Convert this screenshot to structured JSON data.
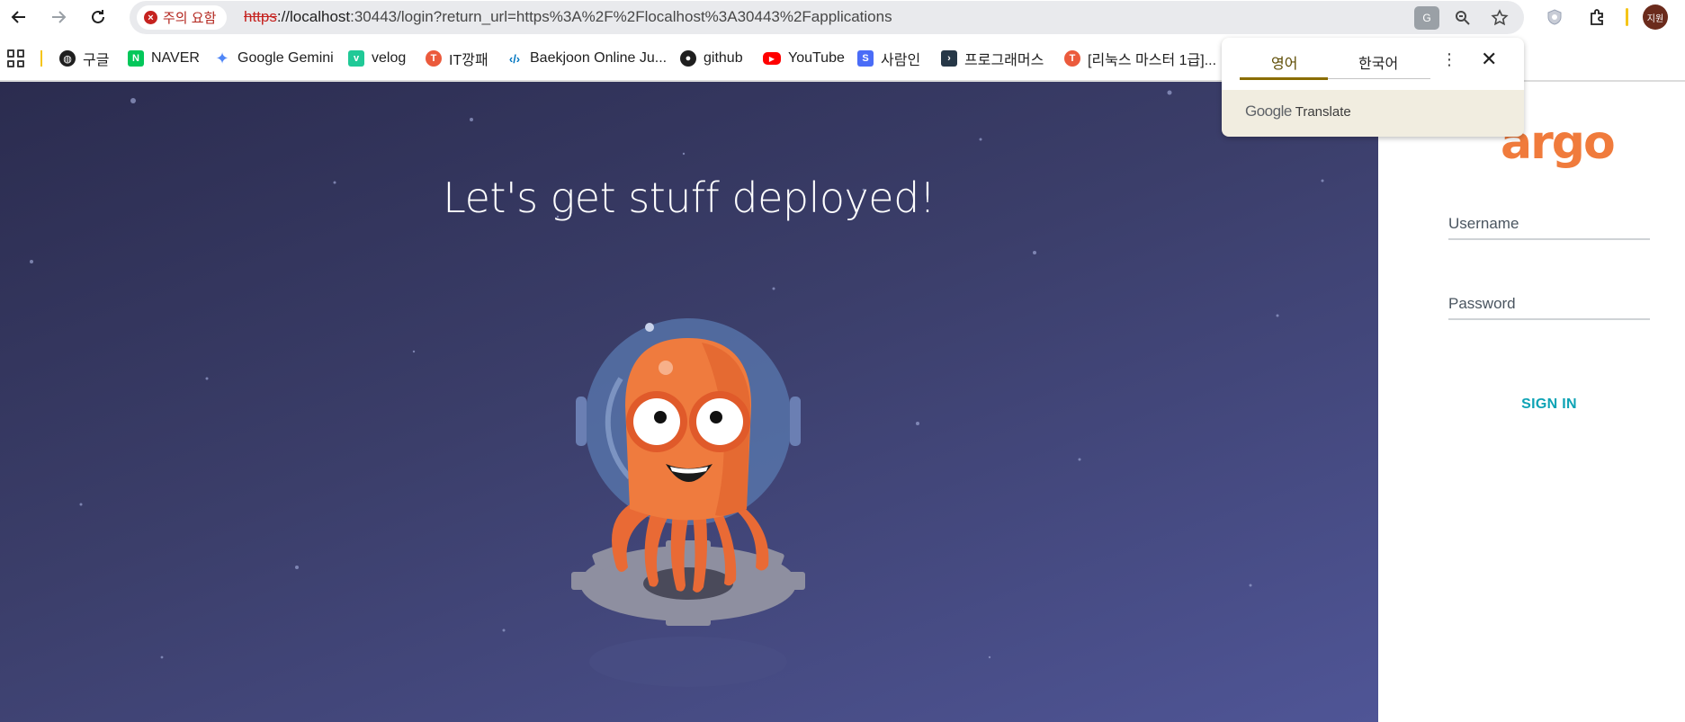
{
  "browser": {
    "security_chip": "주의 요함",
    "url_scheme": "https",
    "url_host": "://localhost",
    "url_rest": ":30443/login?return_url=https%3A%2F%2Flocalhost%3A30443%2Fapplications",
    "avatar_text": "지원"
  },
  "bookmarks": [
    {
      "label": "구글",
      "icon": "globe-icon",
      "color": "#1f1f1f"
    },
    {
      "label": "NAVER",
      "icon": "naver-icon",
      "color": "#03c75a"
    },
    {
      "label": "Google Gemini",
      "icon": "gemini-icon",
      "color": "#4f86f7"
    },
    {
      "label": "velog",
      "icon": "velog-icon",
      "color": "#20c997"
    },
    {
      "label": "IT깡패",
      "icon": "tistory-icon",
      "color": "#eb5a3c"
    },
    {
      "label": "Baekjoon Online Ju...",
      "icon": "code-icon",
      "color": "#0076c0"
    },
    {
      "label": "github",
      "icon": "github-icon",
      "color": "#1f1f1f"
    },
    {
      "label": "YouTube",
      "icon": "youtube-icon",
      "color": "#ff0000"
    },
    {
      "label": "사람인",
      "icon": "saramin-icon",
      "color": "#4a6cf7"
    },
    {
      "label": "프로그래머스",
      "icon": "programmers-icon",
      "color": "#263747"
    },
    {
      "label": "[리눅스 마스터 1급]...",
      "icon": "tistory-icon",
      "color": "#eb5a3c"
    }
  ],
  "translate_popup": {
    "tab_source": "영어",
    "tab_target": "한국어",
    "brand_google": "Google",
    "brand_translate": "Translate"
  },
  "hero": {
    "title": "Let's get stuff deployed!"
  },
  "login": {
    "logo": "argo",
    "username_placeholder": "Username",
    "password_placeholder": "Password",
    "signin_label": "SIGN IN"
  }
}
